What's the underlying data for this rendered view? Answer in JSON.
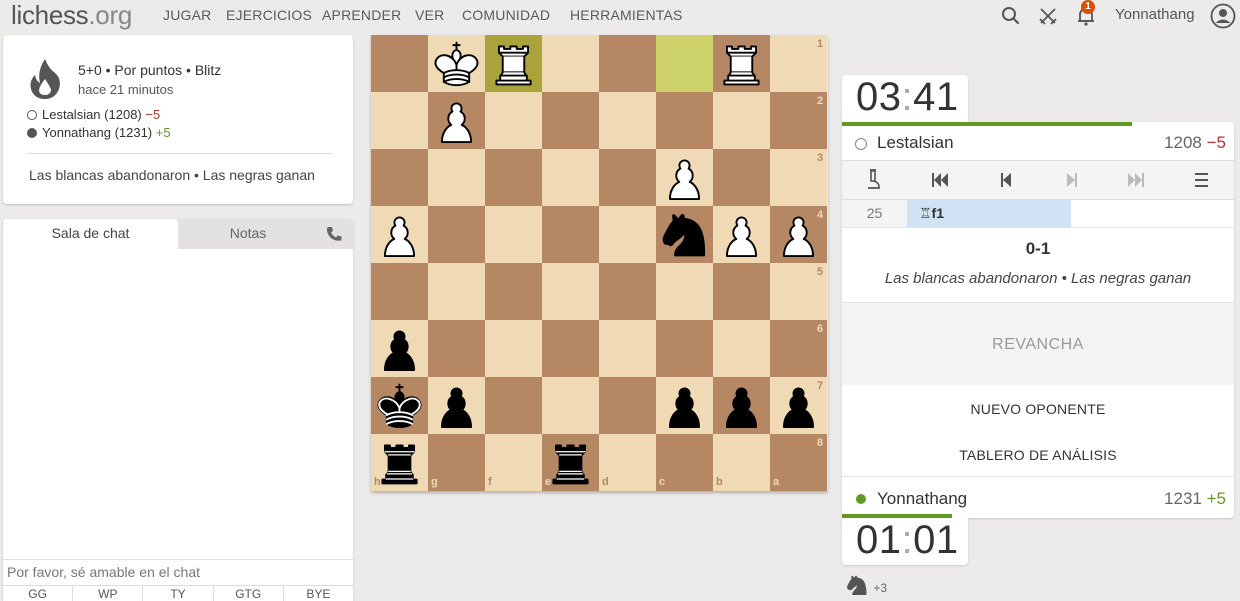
{
  "brand": {
    "name": "lichess",
    "tld": ".org"
  },
  "nav": [
    "JUGAR",
    "EJERCICIOS",
    "APRENDER",
    "VER",
    "COMUNIDAD",
    "HERRAMIENTAS"
  ],
  "header": {
    "username": "Yonnathang",
    "notification_count": "1"
  },
  "game": {
    "meta": "5+0 • Por puntos • Blitz",
    "time_ago": "hace 21 minutos",
    "white": {
      "name": "Lestalsian",
      "rating": "(1208)",
      "diff": "−5"
    },
    "black": {
      "name": "Yonnathang",
      "rating": "(1231)",
      "diff": "+5"
    },
    "result": "Las blancas abandonaron • Las negras ganan"
  },
  "chat": {
    "tabs": [
      "Sala de chat",
      "Notas"
    ],
    "placeholder": "Por favor, sé amable en el chat",
    "presets": [
      "GG",
      "WP",
      "TY",
      "GTG",
      "BYE"
    ]
  },
  "board": {
    "orientation": "black",
    "files_bottom": [
      "h",
      "g",
      "f",
      "e",
      "d",
      "c",
      "b",
      "a"
    ],
    "ranks_right": [
      "1",
      "2",
      "3",
      "4",
      "5",
      "6",
      "7",
      "8"
    ],
    "last_move": [
      "f1",
      "c1"
    ],
    "pieces": [
      {
        "sq": "g1",
        "piece": "white-king"
      },
      {
        "sq": "f1",
        "piece": "white-rook"
      },
      {
        "sq": "b1",
        "piece": "white-rook"
      },
      {
        "sq": "g2",
        "piece": "white-pawn"
      },
      {
        "sq": "c3",
        "piece": "white-pawn"
      },
      {
        "sq": "h4",
        "piece": "white-pawn"
      },
      {
        "sq": "b4",
        "piece": "white-pawn"
      },
      {
        "sq": "a4",
        "piece": "white-pawn"
      },
      {
        "sq": "c4",
        "piece": "black-knight"
      },
      {
        "sq": "h6",
        "piece": "black-pawn"
      },
      {
        "sq": "h7",
        "piece": "black-king"
      },
      {
        "sq": "g7",
        "piece": "black-pawn"
      },
      {
        "sq": "c7",
        "piece": "black-pawn"
      },
      {
        "sq": "b7",
        "piece": "black-pawn"
      },
      {
        "sq": "a7",
        "piece": "black-pawn"
      },
      {
        "sq": "h8",
        "piece": "black-rook"
      },
      {
        "sq": "e8",
        "piece": "black-rook"
      }
    ]
  },
  "clocks": {
    "top": {
      "min": "03",
      "sec": "41"
    },
    "bottom": {
      "min": "01",
      "sec": "01"
    }
  },
  "players_panel": {
    "top": {
      "name": "Lestalsian",
      "rating": "1208",
      "diff": "−5"
    },
    "bottom": {
      "name": "Yonnathang",
      "rating": "1231",
      "diff": "+5"
    }
  },
  "moves": {
    "index": "25",
    "move": "♖f1"
  },
  "outcome": {
    "score": "0-1",
    "text": "Las blancas abandonaron • Las negras ganan"
  },
  "actions": {
    "rematch": "REVANCHA",
    "new_opponent": "NUEVO OPONENTE",
    "analysis": "TABLERO DE ANÁLISIS"
  },
  "material": {
    "diff": "+3"
  },
  "colors": {
    "accent_green": "#629924",
    "loss_red": "#b33430",
    "board_light": "#f0d9b5",
    "board_dark": "#b58863"
  }
}
